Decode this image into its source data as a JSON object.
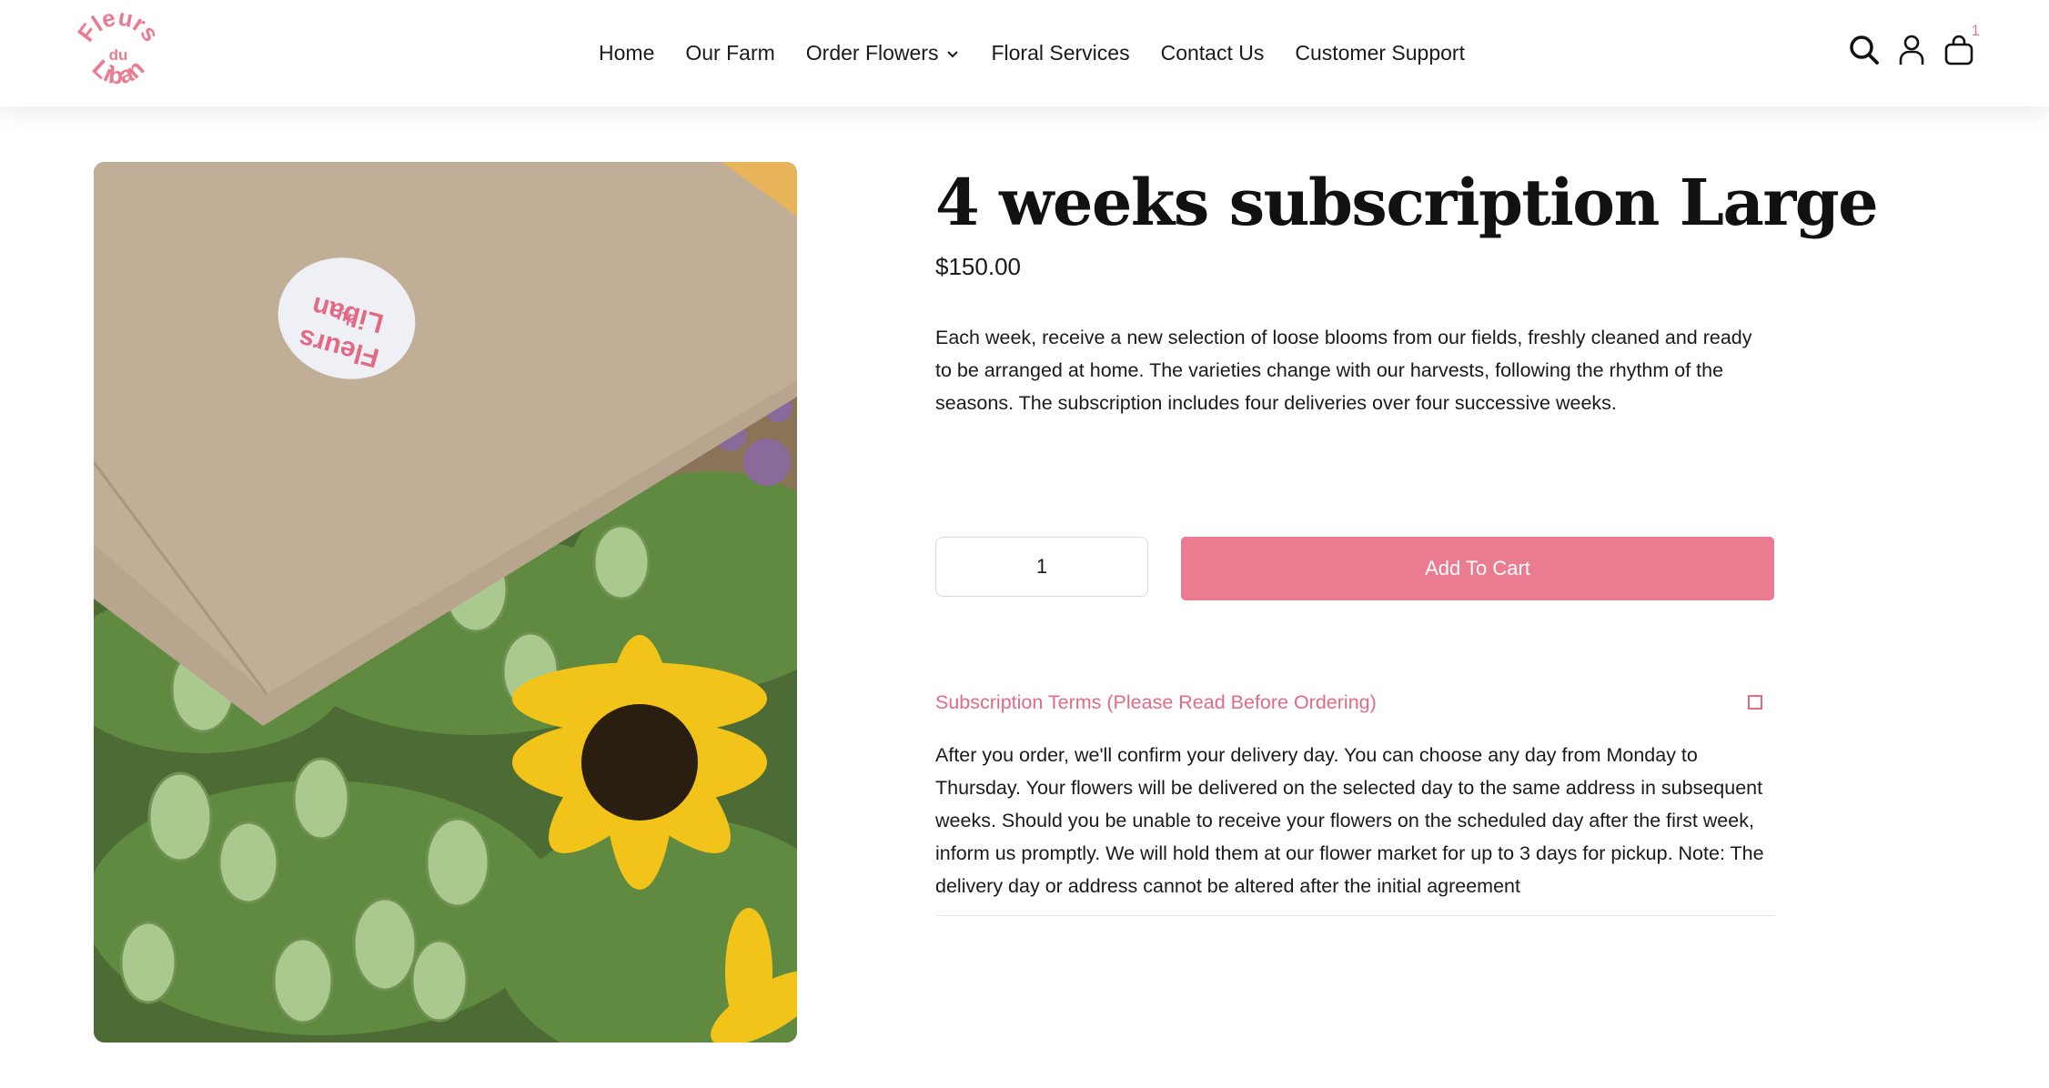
{
  "header": {
    "logo_text": "Fleurs du Liban",
    "nav": [
      {
        "label": "Home"
      },
      {
        "label": "Our Farm"
      },
      {
        "label": "Order Flowers",
        "has_dropdown": true
      },
      {
        "label": "Floral Services"
      },
      {
        "label": "Contact Us"
      },
      {
        "label": "Customer Support"
      }
    ],
    "icons": [
      "search-icon",
      "account-icon",
      "cart-icon"
    ],
    "cart_count": "1"
  },
  "product": {
    "image_sticker_text": "Fleurs du Liban",
    "title": "4 weeks subscription Large",
    "price": "$150.00",
    "description": "Each week, receive a new selection of loose blooms from our fields, freshly cleaned and ready to be arranged at home. The varieties change with our harvests, following the rhythm of the seasons. The subscription includes four deliveries over four successive weeks.",
    "quantity": "1",
    "add_to_cart_label": "Add To Cart"
  },
  "accordion": {
    "title": "Subscription Terms (Please Read Before Ordering)",
    "body": "After you order, we'll confirm your delivery day. You can choose any day from Monday to Thursday. Your flowers will be delivered on the selected day to the same address in subsequent weeks. Should you be unable to receive your flowers on the scheduled day after the first week, inform us promptly. We will hold them at our flower market for up to 3 days for pickup. Note: The delivery day or address cannot be altered after the initial agreement"
  },
  "colors": {
    "brand_pink": "#eb7b90",
    "accent_text_pink": "#e36a84",
    "text": "#1a1a1a"
  }
}
